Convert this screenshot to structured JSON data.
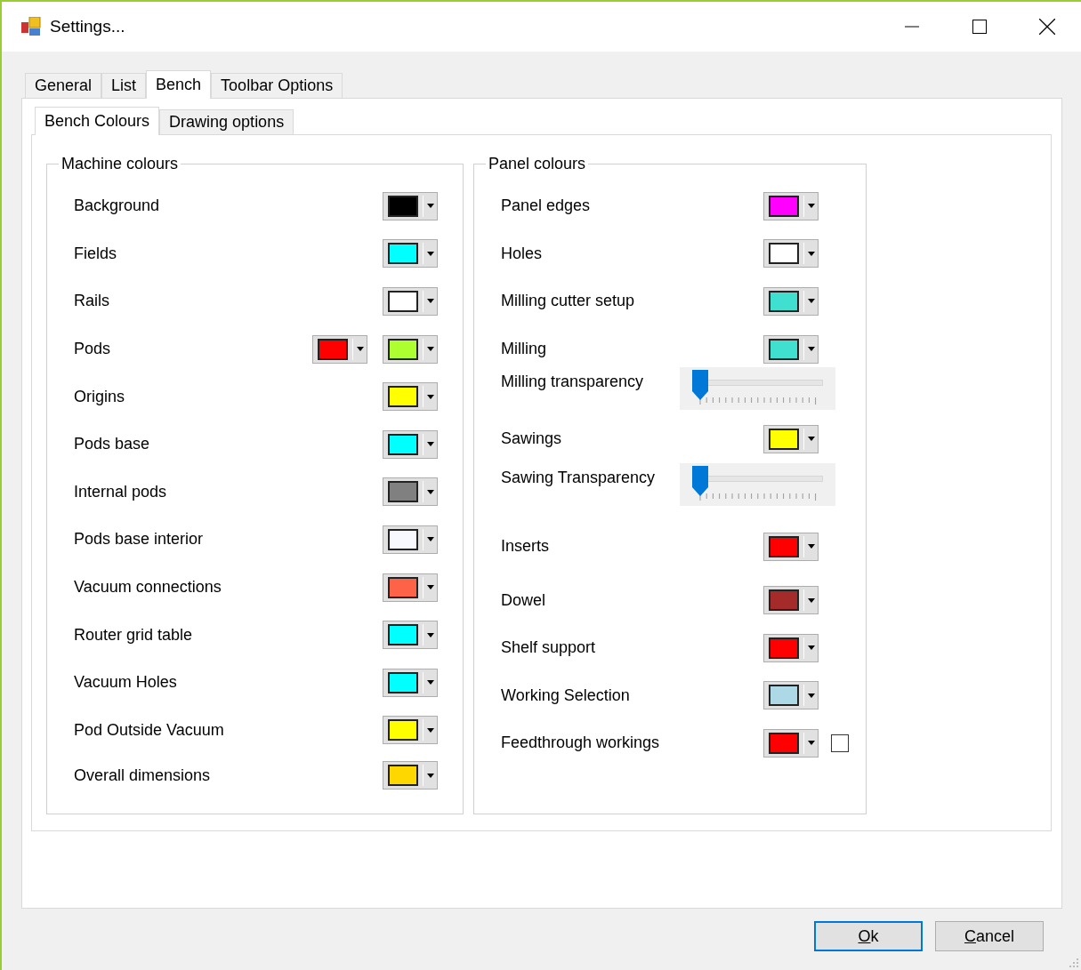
{
  "window": {
    "title": "Settings..."
  },
  "tabs": [
    {
      "label": "General",
      "selected": false
    },
    {
      "label": "List",
      "selected": false
    },
    {
      "label": "Bench",
      "selected": true
    },
    {
      "label": "Toolbar Options",
      "selected": false
    }
  ],
  "subtabs": [
    {
      "label": "Bench Colours",
      "selected": true
    },
    {
      "label": "Drawing options",
      "selected": false
    }
  ],
  "machine_colours": {
    "title": "Machine colours",
    "rows": [
      {
        "label": "Background",
        "pickers": [
          {
            "color": "#000000"
          }
        ]
      },
      {
        "label": "Fields",
        "pickers": [
          {
            "color": "#00ffff"
          }
        ]
      },
      {
        "label": "Rails",
        "pickers": [
          {
            "color": "#ffffff"
          }
        ]
      },
      {
        "label": "Pods",
        "pickers": [
          {
            "color": "#ff0000"
          },
          {
            "color": "#adff2f"
          }
        ]
      },
      {
        "label": "Origins",
        "pickers": [
          {
            "color": "#ffff00"
          }
        ]
      },
      {
        "label": "Pods base",
        "pickers": [
          {
            "color": "#00ffff"
          }
        ]
      },
      {
        "label": "Internal pods",
        "pickers": [
          {
            "color": "#808080"
          }
        ]
      },
      {
        "label": "Pods base interior",
        "pickers": [
          {
            "color": "#f8f8ff"
          }
        ]
      },
      {
        "label": "Vacuum connections",
        "pickers": [
          {
            "color": "#ff6347"
          }
        ]
      },
      {
        "label": "Router grid table",
        "pickers": [
          {
            "color": "#00ffff"
          }
        ]
      },
      {
        "label": "Vacuum Holes",
        "pickers": [
          {
            "color": "#00ffff"
          }
        ]
      },
      {
        "label": "Pod Outside Vacuum",
        "pickers": [
          {
            "color": "#ffff00"
          }
        ]
      },
      {
        "label": "Overall dimensions",
        "pickers": [
          {
            "color": "#ffd700"
          }
        ]
      }
    ]
  },
  "panel_colours": {
    "title": "Panel colours",
    "rows": [
      {
        "kind": "color",
        "label": "Panel edges",
        "color": "#ff00ff"
      },
      {
        "kind": "color",
        "label": "Holes",
        "color": "#ffffff"
      },
      {
        "kind": "color",
        "label": "Milling cutter setup",
        "color": "#40e0d0"
      },
      {
        "kind": "color",
        "label": "Milling",
        "color": "#40e0d0"
      },
      {
        "kind": "slider",
        "label": "Milling transparency",
        "level": 0
      },
      {
        "kind": "color",
        "label": "Sawings",
        "color": "#ffff00"
      },
      {
        "kind": "slider",
        "label": "Sawing Transparency",
        "level": 0
      },
      {
        "kind": "color",
        "label": "Inserts",
        "color": "#ff0000"
      },
      {
        "kind": "color",
        "label": "Dowel",
        "color": "#a52a2a"
      },
      {
        "kind": "color",
        "label": "Shelf support",
        "color": "#ff0000"
      },
      {
        "kind": "color",
        "label": "Working Selection",
        "color": "#add8e6"
      },
      {
        "kind": "color",
        "label": "Feedthrough workings",
        "color": "#ff0000",
        "checked": false
      }
    ]
  },
  "buttons": [
    {
      "key": "O",
      "rest": "k",
      "default": true
    },
    {
      "key": "C",
      "rest": "ancel",
      "default": false
    }
  ]
}
